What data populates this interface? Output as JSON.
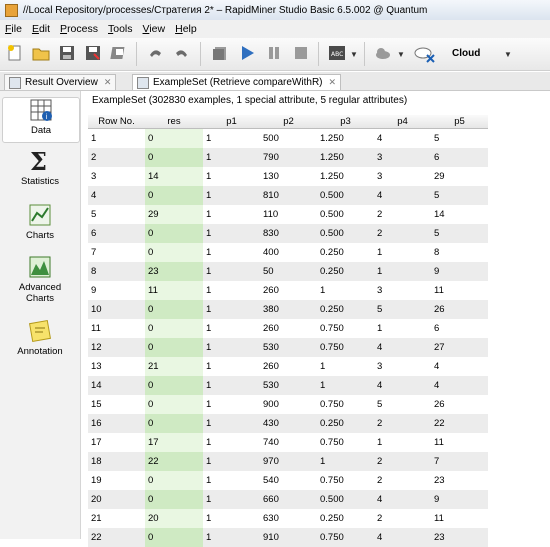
{
  "window": {
    "title": "//Local Repository/processes/Стратегия 2* – RapidMiner Studio Basic 6.5.002 @ Quantum"
  },
  "menu": [
    {
      "label": "File",
      "mnemonic": "F",
      "rest": "ile"
    },
    {
      "label": "Edit",
      "mnemonic": "E",
      "rest": "dit"
    },
    {
      "label": "Process",
      "mnemonic": "P",
      "rest": "rocess"
    },
    {
      "label": "Tools",
      "mnemonic": "T",
      "rest": "ools"
    },
    {
      "label": "View",
      "mnemonic": "V",
      "rest": "iew"
    },
    {
      "label": "Help",
      "mnemonic": "H",
      "rest": "elp"
    }
  ],
  "toolbar": {
    "cloud_label": "Cloud"
  },
  "tabs": [
    {
      "label": "Result Overview",
      "close": "✕"
    },
    {
      "label": "ExampleSet (Retrieve compareWithR)",
      "close": "✕"
    }
  ],
  "sidebar": [
    {
      "label": "Data",
      "icon": "data-table-icon"
    },
    {
      "label": "Statistics",
      "icon": "sigma-icon"
    },
    {
      "label": "Charts",
      "icon": "chart-icon"
    },
    {
      "label": "Advanced\nCharts",
      "icon": "advanced-chart-icon"
    },
    {
      "label": "Annotation",
      "icon": "annotation-icon"
    }
  ],
  "summary": "ExampleSet (302830 examples, 1 special attribute, 5 regular attributes)",
  "table": {
    "columns": [
      "Row No.",
      "res",
      "p1",
      "p2",
      "p3",
      "p4",
      "p5"
    ],
    "rows": [
      [
        "1",
        "0",
        "1",
        "500",
        "1.250",
        "4",
        "5"
      ],
      [
        "2",
        "0",
        "1",
        "790",
        "1.250",
        "3",
        "6"
      ],
      [
        "3",
        "14",
        "1",
        "130",
        "1.250",
        "3",
        "29"
      ],
      [
        "4",
        "0",
        "1",
        "810",
        "0.500",
        "4",
        "5"
      ],
      [
        "5",
        "29",
        "1",
        "110",
        "0.500",
        "2",
        "14"
      ],
      [
        "6",
        "0",
        "1",
        "830",
        "0.500",
        "2",
        "5"
      ],
      [
        "7",
        "0",
        "1",
        "400",
        "0.250",
        "1",
        "8"
      ],
      [
        "8",
        "23",
        "1",
        "50",
        "0.250",
        "1",
        "9"
      ],
      [
        "9",
        "11",
        "1",
        "260",
        "1",
        "3",
        "11"
      ],
      [
        "10",
        "0",
        "1",
        "380",
        "0.250",
        "5",
        "26"
      ],
      [
        "11",
        "0",
        "1",
        "260",
        "0.750",
        "1",
        "6"
      ],
      [
        "12",
        "0",
        "1",
        "530",
        "0.750",
        "4",
        "27"
      ],
      [
        "13",
        "21",
        "1",
        "260",
        "1",
        "3",
        "4"
      ],
      [
        "14",
        "0",
        "1",
        "530",
        "1",
        "4",
        "4"
      ],
      [
        "15",
        "0",
        "1",
        "900",
        "0.750",
        "5",
        "26"
      ],
      [
        "16",
        "0",
        "1",
        "430",
        "0.250",
        "2",
        "22"
      ],
      [
        "17",
        "17",
        "1",
        "740",
        "0.750",
        "1",
        "11"
      ],
      [
        "18",
        "22",
        "1",
        "970",
        "1",
        "2",
        "7"
      ],
      [
        "19",
        "0",
        "1",
        "540",
        "0.750",
        "2",
        "23"
      ],
      [
        "20",
        "0",
        "1",
        "660",
        "0.500",
        "4",
        "9"
      ],
      [
        "21",
        "20",
        "1",
        "630",
        "0.250",
        "2",
        "11"
      ],
      [
        "22",
        "0",
        "1",
        "910",
        "0.750",
        "4",
        "23"
      ]
    ]
  }
}
